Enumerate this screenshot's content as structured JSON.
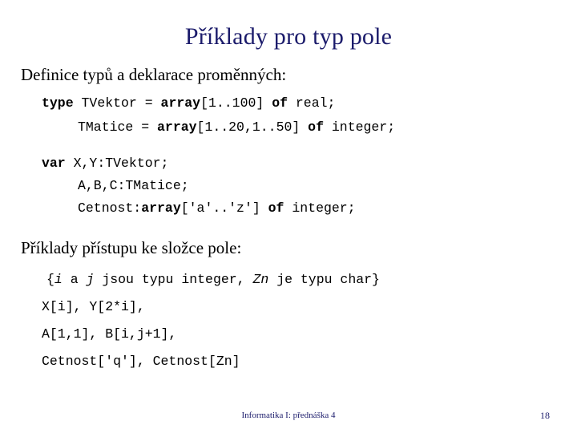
{
  "slide": {
    "title": "Příklady pro typ pole",
    "background_color": "#ffffff",
    "title_color": "#1b1b6b",
    "body_color": "#000000"
  },
  "section_one": {
    "heading": "Definice typů a deklarace proměnných:",
    "code_lines": [
      {
        "indent": 0,
        "tokens": [
          {
            "text": "type ",
            "style": "bold"
          },
          {
            "text": "TVektor = ",
            "style": "normal"
          },
          {
            "text": "array",
            "style": "bold"
          },
          {
            "text": "[1..100] ",
            "style": "normal"
          },
          {
            "text": "of",
            "style": "bold"
          },
          {
            "text": " real;",
            "style": "normal"
          }
        ],
        "plain": "type TVektor = array[1..100] of real;"
      },
      {
        "indent": 1,
        "tokens": [
          {
            "text": "TMatice = ",
            "style": "normal"
          },
          {
            "text": "array",
            "style": "bold"
          },
          {
            "text": "[1..20,1..50] ",
            "style": "normal"
          },
          {
            "text": "of",
            "style": "bold"
          },
          {
            "text": " integer;",
            "style": "normal"
          }
        ],
        "plain": "TMatice = array[1..20,1..50] of integer;"
      },
      {
        "indent": 0,
        "tokens": [
          {
            "text": "var ",
            "style": "bold"
          },
          {
            "text": "X,Y:TVektor;",
            "style": "normal"
          }
        ],
        "plain": "var X,Y:TVektor;"
      },
      {
        "indent": 1,
        "tokens": [
          {
            "text": "A,B,C:TMatice;",
            "style": "normal"
          }
        ],
        "plain": "A,B,C:TMatice;"
      },
      {
        "indent": 1,
        "tokens": [
          {
            "text": "Cetnost:",
            "style": "normal"
          },
          {
            "text": "array",
            "style": "bold"
          },
          {
            "text": "['a'..'z'] ",
            "style": "normal"
          },
          {
            "text": "of",
            "style": "bold"
          },
          {
            "text": " integer;",
            "style": "normal"
          }
        ],
        "plain": "Cetnost:array['a'..'z'] of integer;"
      }
    ]
  },
  "section_two": {
    "heading": "Příklady přístupu ke složce pole:",
    "comment_line": {
      "tokens": [
        {
          "text": "{",
          "style": "normal"
        },
        {
          "text": "i",
          "style": "italic"
        },
        {
          "text": " a ",
          "style": "normal"
        },
        {
          "text": "j",
          "style": "italic"
        },
        {
          "text": " jsou typu integer, ",
          "style": "normal"
        },
        {
          "text": "Zn",
          "style": "italic"
        },
        {
          "text": " je typu char}",
          "style": "normal"
        }
      ],
      "plain": "{i a j jsou typu integer, Zn je typu char}"
    },
    "expressions": [
      "X[i], Y[2*i],",
      "A[1,1], B[i,j+1],",
      "Cetnost['q'], Cetnost[Zn]"
    ]
  },
  "footer": {
    "text": "Informatika I: přednáška 4",
    "page_number": "18",
    "color": "#1b1b6b"
  }
}
